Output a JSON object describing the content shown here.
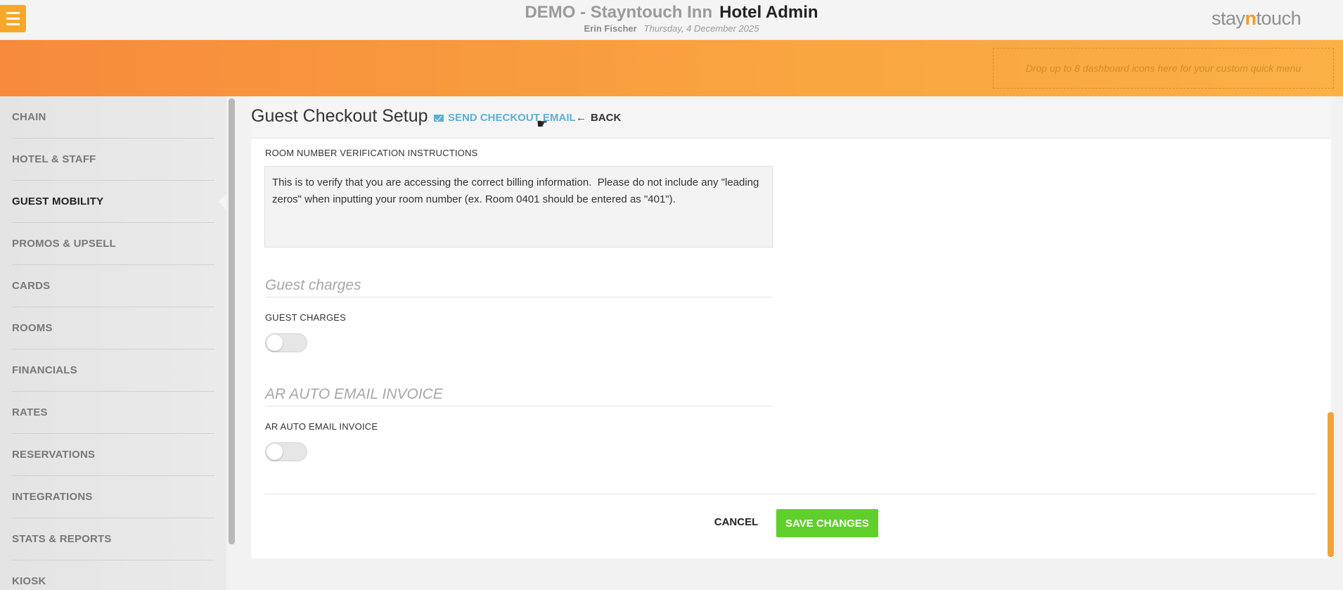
{
  "header": {
    "hotel_name": "DEMO - Stayntouch Inn",
    "app_name": "Hotel Admin",
    "user_name": "Erin Fischer",
    "date": "Thursday, 4 December 2025",
    "logo_prefix": "stay",
    "logo_n": "n",
    "logo_suffix": "touch"
  },
  "banner": {
    "quick_menu_text": "Drop up to 8 dashboard icons here for your custom quick menu"
  },
  "sidebar": {
    "items": [
      {
        "label": "CHAIN"
      },
      {
        "label": "HOTEL & STAFF"
      },
      {
        "label": "GUEST MOBILITY",
        "active": true
      },
      {
        "label": "PROMOS & UPSELL"
      },
      {
        "label": "CARDS"
      },
      {
        "label": "ROOMS"
      },
      {
        "label": "FINANCIALS"
      },
      {
        "label": "RATES"
      },
      {
        "label": "RESERVATIONS"
      },
      {
        "label": "INTEGRATIONS"
      },
      {
        "label": "STATS & REPORTS"
      },
      {
        "label": "KIOSK"
      }
    ]
  },
  "page": {
    "title": "Guest Checkout Setup",
    "send_email_label": "SEND CHECKOUT EMAIL",
    "back_label": "BACK"
  },
  "form": {
    "room_verification_label": "ROOM NUMBER VERIFICATION INSTRUCTIONS",
    "room_verification_text": "This is to verify that you are accessing the correct billing information.  Please do not include any \"leading zeros\" when inputting your room number (ex. Room 0401 should be entered as \"401\").",
    "guest_charges_section": "Guest charges",
    "guest_charges_label": "GUEST CHARGES",
    "guest_charges_on": false,
    "ar_section": "AR AUTO EMAIL INVOICE",
    "ar_label": "AR AUTO EMAIL INVOICE",
    "ar_on": false
  },
  "actions": {
    "cancel_label": "CANCEL",
    "save_label": "SAVE CHANGES"
  }
}
